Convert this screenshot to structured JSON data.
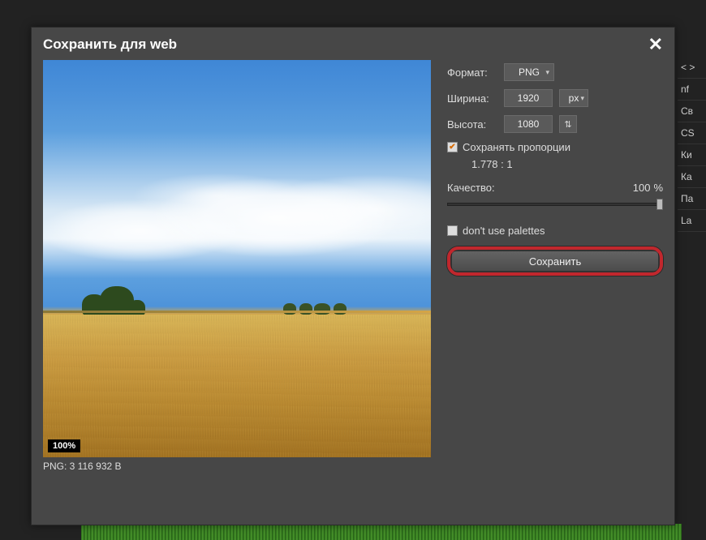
{
  "dialog": {
    "title": "Сохранить для web",
    "close_glyph": "✕"
  },
  "preview": {
    "zoom": "100%",
    "filesize": "PNG: 3 116 932 B"
  },
  "controls": {
    "format_label": "Формат:",
    "format_value": "PNG",
    "width_label": "Ширина:",
    "width_value": "1920",
    "width_unit": "px",
    "height_label": "Высота:",
    "height_value": "1080",
    "swap_glyph": "⇅",
    "keep_ratio_checked": "✔",
    "keep_ratio_label": "Сохранять пропорции",
    "ratio_text": "1.778 : 1",
    "quality_label": "Качество:",
    "quality_value": "100",
    "quality_pct": "%",
    "palettes_label": "don't use palettes",
    "save_button": "Сохранить"
  },
  "bg": {
    "items": [
      "< >",
      "nf",
      "Св",
      "CS",
      "Ки",
      "Ка",
      "Па",
      "La"
    ]
  }
}
